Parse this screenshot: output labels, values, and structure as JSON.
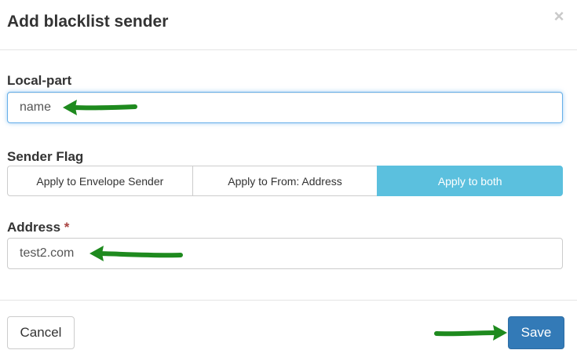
{
  "dialog": {
    "title": "Add blacklist sender",
    "close_glyph": "×"
  },
  "local_part": {
    "label": "Local-part",
    "value": "name"
  },
  "sender_flag": {
    "label": "Sender Flag",
    "options": [
      {
        "label": "Apply to Envelope Sender",
        "selected": false
      },
      {
        "label": "Apply to From: Address",
        "selected": false
      },
      {
        "label": "Apply to both",
        "selected": true
      }
    ]
  },
  "address": {
    "label": "Address",
    "required_mark": "*",
    "value": "test2.com"
  },
  "footer": {
    "cancel_label": "Cancel",
    "save_label": "Save"
  },
  "annotations": {
    "arrow_color": "#1e8a1e",
    "arrow_icon": "green-arrow-icon"
  },
  "colors": {
    "primary": "#337ab7",
    "info_active": "#5bc0de",
    "focus_border": "#66afe9",
    "required": "#a94442"
  }
}
